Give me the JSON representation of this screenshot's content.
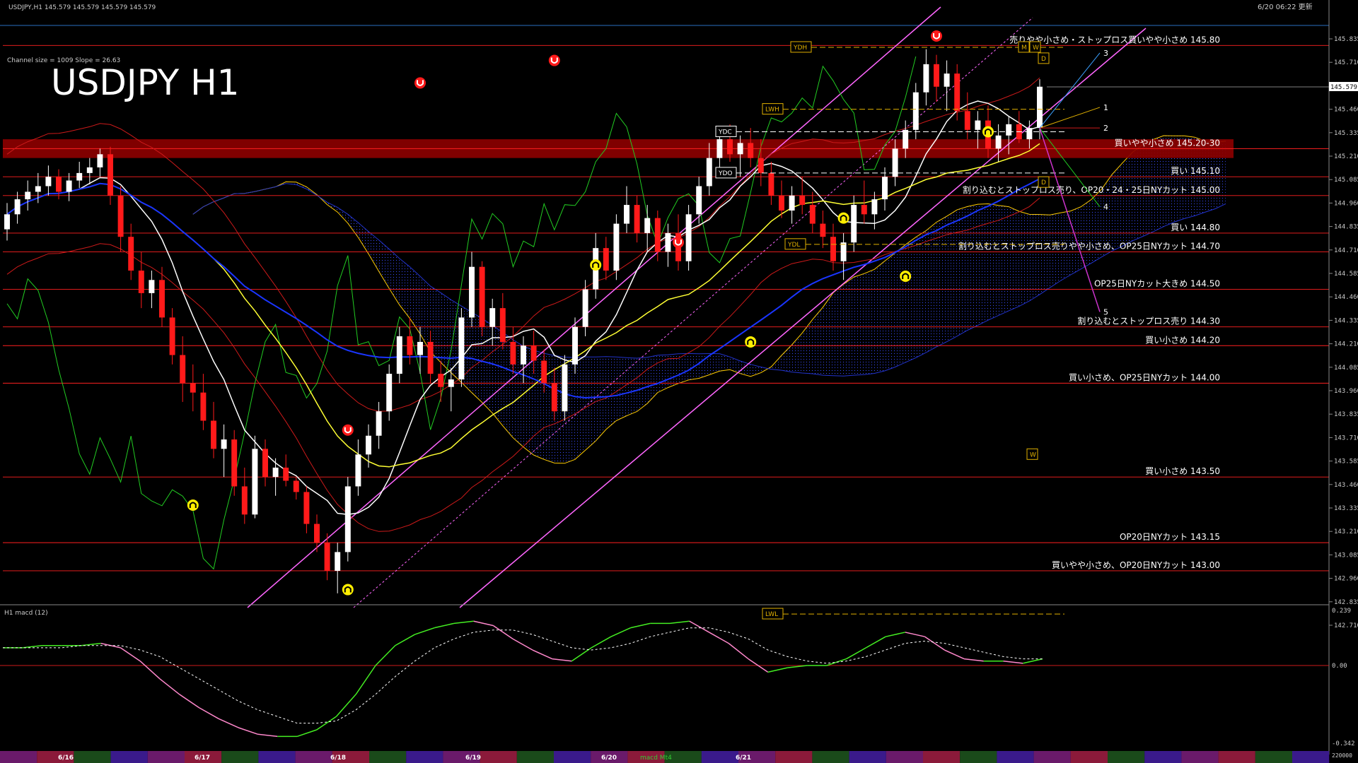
{
  "header": {
    "symbol_line": "USDJPY,H1  145.579 145.579 145.579 145.579",
    "updated": "6/20 06:22 更新",
    "channel_info": "Channel size = 1009 Slope = 26.63",
    "chart_title": "USDJPY H1"
  },
  "subwindow": {
    "label": "H1  macd (12)",
    "scale_top": "0.239",
    "scale_zero": "0.00",
    "scale_bottom": "-0.342",
    "scale_corner": "220000",
    "legend_tag": "macd Mt4"
  },
  "date_labels": [
    "6/16",
    "6/17",
    "6/18",
    "6/19",
    "6/20",
    "6/21"
  ],
  "chart_data": {
    "type": "candlestick",
    "title": "USDJPY H1",
    "ylim": [
      142.71,
      145.9
    ],
    "price_axis_ticks": [
      "145.835",
      "145.710",
      "145.585",
      "145.460",
      "145.335",
      "145.210",
      "145.085",
      "144.960",
      "144.835",
      "144.710",
      "144.585",
      "144.460",
      "144.335",
      "144.210",
      "144.085",
      "143.960",
      "143.835",
      "143.710",
      "143.585",
      "143.460",
      "143.335",
      "143.210",
      "143.085",
      "142.960",
      "142.835",
      "142.710"
    ],
    "current_price": "145.579",
    "candles": [
      [
        144.82,
        144.96,
        144.76,
        144.9
      ],
      [
        144.9,
        145.02,
        144.85,
        144.98
      ],
      [
        144.98,
        145.08,
        144.92,
        145.02
      ],
      [
        145.02,
        145.12,
        144.96,
        145.05
      ],
      [
        145.05,
        145.16,
        145.0,
        145.1
      ],
      [
        145.1,
        145.14,
        144.98,
        145.02
      ],
      [
        145.02,
        145.12,
        144.97,
        145.08
      ],
      [
        145.08,
        145.18,
        145.04,
        145.12
      ],
      [
        145.12,
        145.2,
        145.06,
        145.15
      ],
      [
        145.15,
        145.25,
        145.1,
        145.22
      ],
      [
        145.22,
        145.26,
        144.95,
        145.0
      ],
      [
        145.0,
        145.05,
        144.7,
        144.78
      ],
      [
        144.78,
        144.85,
        144.55,
        144.6
      ],
      [
        144.6,
        144.7,
        144.4,
        144.48
      ],
      [
        144.48,
        144.6,
        144.4,
        144.55
      ],
      [
        144.55,
        144.62,
        144.3,
        144.35
      ],
      [
        144.35,
        144.4,
        144.1,
        144.15
      ],
      [
        144.15,
        144.25,
        143.9,
        144.0
      ],
      [
        144.0,
        144.1,
        143.85,
        143.95
      ],
      [
        143.95,
        144.05,
        143.75,
        143.8
      ],
      [
        143.8,
        143.9,
        143.6,
        143.65
      ],
      [
        143.65,
        143.78,
        143.5,
        143.7
      ],
      [
        143.7,
        143.75,
        143.4,
        143.45
      ],
      [
        143.45,
        143.55,
        143.25,
        143.3
      ],
      [
        143.3,
        143.72,
        143.28,
        143.65
      ],
      [
        143.65,
        143.7,
        143.45,
        143.5
      ],
      [
        143.5,
        143.6,
        143.4,
        143.55
      ],
      [
        143.55,
        143.62,
        143.45,
        143.48
      ],
      [
        143.48,
        143.5,
        143.38,
        143.42
      ],
      [
        143.42,
        143.45,
        143.2,
        143.25
      ],
      [
        143.25,
        143.3,
        143.1,
        143.15
      ],
      [
        143.15,
        143.2,
        142.95,
        143.0
      ],
      [
        143.0,
        143.15,
        142.88,
        143.1
      ],
      [
        143.1,
        143.5,
        143.05,
        143.45
      ],
      [
        143.45,
        143.7,
        143.4,
        143.62
      ],
      [
        143.62,
        143.78,
        143.55,
        143.72
      ],
      [
        143.72,
        143.9,
        143.65,
        143.85
      ],
      [
        143.85,
        144.1,
        143.8,
        144.05
      ],
      [
        144.05,
        144.3,
        144.0,
        144.25
      ],
      [
        144.25,
        144.35,
        144.1,
        144.15
      ],
      [
        144.15,
        144.3,
        144.05,
        144.22
      ],
      [
        144.22,
        144.28,
        144.0,
        144.05
      ],
      [
        144.05,
        144.12,
        143.9,
        143.98
      ],
      [
        143.98,
        144.08,
        143.85,
        144.02
      ],
      [
        144.02,
        144.4,
        143.98,
        144.35
      ],
      [
        144.35,
        144.7,
        144.3,
        144.62
      ],
      [
        144.62,
        144.65,
        144.25,
        144.3
      ],
      [
        144.3,
        144.45,
        144.2,
        144.4
      ],
      [
        144.4,
        144.48,
        144.18,
        144.22
      ],
      [
        144.22,
        144.3,
        144.05,
        144.1
      ],
      [
        144.1,
        144.25,
        144.0,
        144.2
      ],
      [
        144.2,
        144.28,
        144.05,
        144.12
      ],
      [
        144.12,
        144.18,
        143.95,
        144.0
      ],
      [
        144.0,
        144.08,
        143.8,
        143.85
      ],
      [
        143.85,
        144.15,
        143.8,
        144.1
      ],
      [
        144.1,
        144.35,
        144.05,
        144.3
      ],
      [
        144.3,
        144.55,
        144.25,
        144.5
      ],
      [
        144.5,
        144.8,
        144.45,
        144.72
      ],
      [
        144.72,
        144.78,
        144.55,
        144.6
      ],
      [
        144.6,
        144.9,
        144.55,
        144.85
      ],
      [
        144.85,
        145.05,
        144.8,
        144.95
      ],
      [
        144.95,
        145.0,
        144.75,
        144.8
      ],
      [
        144.8,
        144.95,
        144.7,
        144.88
      ],
      [
        144.88,
        144.92,
        144.65,
        144.7
      ],
      [
        144.7,
        144.85,
        144.62,
        144.8
      ],
      [
        144.8,
        144.9,
        144.6,
        144.65
      ],
      [
        144.65,
        144.95,
        144.6,
        144.9
      ],
      [
        144.9,
        145.1,
        144.85,
        145.05
      ],
      [
        145.05,
        145.28,
        145.0,
        145.2
      ],
      [
        145.2,
        145.35,
        145.15,
        145.3
      ],
      [
        145.3,
        145.38,
        145.18,
        145.22
      ],
      [
        145.22,
        145.32,
        145.1,
        145.28
      ],
      [
        145.28,
        145.36,
        145.15,
        145.2
      ],
      [
        145.2,
        145.3,
        145.05,
        145.12
      ],
      [
        145.12,
        145.18,
        144.95,
        145.0
      ],
      [
        145.0,
        145.08,
        144.88,
        144.92
      ],
      [
        144.92,
        145.05,
        144.85,
        145.0
      ],
      [
        145.0,
        145.1,
        144.9,
        144.95
      ],
      [
        144.95,
        145.02,
        144.8,
        144.85
      ],
      [
        144.85,
        144.92,
        144.72,
        144.78
      ],
      [
        144.78,
        144.85,
        144.6,
        144.65
      ],
      [
        144.65,
        144.8,
        144.55,
        144.75
      ],
      [
        144.75,
        145.0,
        144.7,
        144.95
      ],
      [
        144.95,
        145.08,
        144.85,
        144.9
      ],
      [
        144.9,
        145.02,
        144.82,
        144.98
      ],
      [
        144.98,
        145.15,
        144.92,
        145.1
      ],
      [
        145.1,
        145.3,
        145.05,
        145.25
      ],
      [
        145.25,
        145.4,
        145.2,
        145.35
      ],
      [
        145.35,
        145.6,
        145.3,
        145.55
      ],
      [
        145.55,
        145.78,
        145.48,
        145.7
      ],
      [
        145.7,
        145.75,
        145.5,
        145.58
      ],
      [
        145.58,
        145.72,
        145.45,
        145.65
      ],
      [
        145.65,
        145.7,
        145.4,
        145.45
      ],
      [
        145.45,
        145.55,
        145.3,
        145.35
      ],
      [
        145.35,
        145.45,
        145.25,
        145.4
      ],
      [
        145.4,
        145.48,
        145.2,
        145.25
      ],
      [
        145.25,
        145.38,
        145.18,
        145.32
      ],
      [
        145.32,
        145.42,
        145.22,
        145.38
      ],
      [
        145.38,
        145.45,
        145.28,
        145.3
      ],
      [
        145.3,
        145.4,
        145.25,
        145.36
      ],
      [
        145.36,
        145.62,
        145.3,
        145.58
      ]
    ],
    "levels": [
      {
        "price": 145.8,
        "label": "売りやや小さめ・ストップロス買いやや小さめ 145.80",
        "color": "#ff2020"
      },
      {
        "price": 145.25,
        "label": "買いやや小さめ 145.20-30",
        "color": "#ff2020",
        "zone_low": 145.2,
        "zone_high": 145.3
      },
      {
        "price": 145.1,
        "label": "買い 145.10",
        "color": "#ff2020"
      },
      {
        "price": 145.0,
        "label": "割り込むとストップロス売り、OP20・24・25日NYカット 145.00",
        "color": "#ff2020"
      },
      {
        "price": 144.8,
        "label": "買い 144.80",
        "color": "#ff2020"
      },
      {
        "price": 144.7,
        "label": "割り込むとストップロス売りやや小さめ、OP25日NYカット 144.70",
        "color": "#ff2020"
      },
      {
        "price": 144.5,
        "label": "OP25日NYカット大きめ 144.50",
        "color": "#ff2020"
      },
      {
        "price": 144.3,
        "label": "割り込むとストップロス売り 144.30",
        "color": "#ff2020"
      },
      {
        "price": 144.2,
        "label": "買い小さめ 144.20",
        "color": "#ff2020"
      },
      {
        "price": 144.0,
        "label": "買い小さめ、OP25日NYカット 144.00",
        "color": "#ff2020"
      },
      {
        "price": 143.5,
        "label": "買い小さめ 143.50",
        "color": "#ff2020"
      },
      {
        "price": 143.15,
        "label": "OP20日NYカット 143.15",
        "color": "#ff2020"
      },
      {
        "price": 143.0,
        "label": "買いやや小さめ、OP20日NYカット 143.00",
        "color": "#ff2020"
      }
    ],
    "markers": [
      {
        "text": "YDH",
        "price": 145.79
      },
      {
        "text": "LWH",
        "price": 145.46
      },
      {
        "text": "YDC",
        "price": 145.34
      },
      {
        "text": "YDO",
        "price": 145.12
      },
      {
        "text": "YDL",
        "price": 144.74
      },
      {
        "text": "LWL",
        "price": 142.77
      },
      {
        "text": "W",
        "price": 143.62
      },
      {
        "text": "D",
        "price": 145.73
      },
      {
        "text": "D",
        "price": 145.07
      },
      {
        "text": "M",
        "price": 145.79
      },
      {
        "text": "W",
        "price": 145.79
      }
    ],
    "wave_labels": [
      "1",
      "2",
      "3",
      "4",
      "5"
    ],
    "colors": {
      "bull": "#ffffff",
      "bear": "#ff1a1a",
      "ma_fast": "#ffffff",
      "ma_mid": "#ffff33",
      "ma_slow": "#1a35ff",
      "channel": "#ff66ff",
      "lagging": "#22cc22",
      "envelope": "#cc1a1a",
      "kumo": "#2f3bbf"
    },
    "macd": {
      "main": [
        0.08,
        0.08,
        0.09,
        0.09,
        0.09,
        0.1,
        0.08,
        0.02,
        -0.06,
        -0.13,
        -0.19,
        -0.24,
        -0.28,
        -0.31,
        -0.32,
        -0.32,
        -0.29,
        -0.23,
        -0.13,
        0.0,
        0.09,
        0.14,
        0.17,
        0.19,
        0.2,
        0.18,
        0.12,
        0.07,
        0.03,
        0.02,
        0.08,
        0.13,
        0.17,
        0.19,
        0.19,
        0.2,
        0.15,
        0.1,
        0.03,
        -0.03,
        -0.01,
        0.0,
        0.0,
        0.03,
        0.08,
        0.13,
        0.15,
        0.13,
        0.07,
        0.03,
        0.02,
        0.02,
        0.01,
        0.03
      ],
      "signal": [
        0.08,
        0.08,
        0.08,
        0.08,
        0.09,
        0.09,
        0.09,
        0.07,
        0.04,
        -0.01,
        -0.06,
        -0.11,
        -0.16,
        -0.2,
        -0.23,
        -0.26,
        -0.26,
        -0.25,
        -0.2,
        -0.13,
        -0.05,
        0.02,
        0.08,
        0.12,
        0.15,
        0.16,
        0.16,
        0.14,
        0.11,
        0.08,
        0.07,
        0.08,
        0.1,
        0.13,
        0.15,
        0.17,
        0.17,
        0.15,
        0.12,
        0.07,
        0.04,
        0.02,
        0.01,
        0.02,
        0.04,
        0.07,
        0.1,
        0.11,
        0.1,
        0.08,
        0.06,
        0.04,
        0.03,
        0.03
      ]
    }
  }
}
